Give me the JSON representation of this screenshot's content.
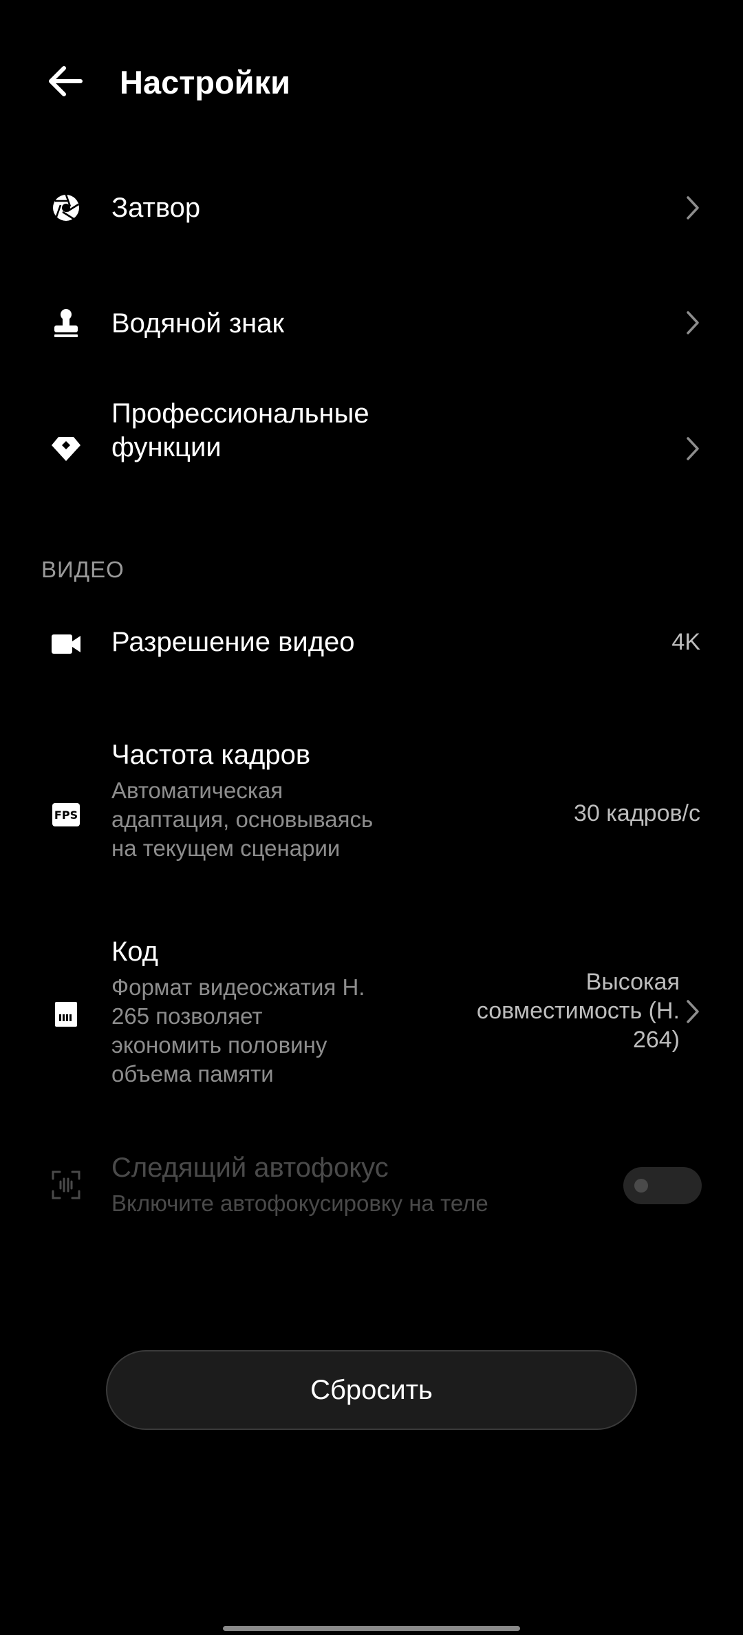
{
  "header": {
    "title": "Настройки",
    "back_icon": "arrow-left-icon"
  },
  "items": {
    "shutter": {
      "label": "Затвор",
      "icon": "aperture-icon"
    },
    "watermark": {
      "label": "Водяной знак",
      "icon": "stamp-icon"
    },
    "pro": {
      "label_line1": "Профессиональные",
      "label_line2": "функции",
      "icon": "diamond-icon"
    }
  },
  "video_section": {
    "header": "ВИДЕО",
    "resolution": {
      "label": "Разрешение видео",
      "value": "4K",
      "icon": "video-camera-icon"
    },
    "framerate": {
      "label": "Частота кадров",
      "subtitle_line1": "Автоматическая",
      "subtitle_line2": "адаптация, основываясь",
      "subtitle_line3": "на текущем сценарии",
      "value": "30 кадров/с",
      "icon": "fps-icon",
      "icon_text": "FPS"
    },
    "codec": {
      "label": "Код",
      "subtitle_line1": "Формат видеосжатия H.",
      "subtitle_line2": "265 позволяет",
      "subtitle_line3": "экономить половину",
      "subtitle_line4": "объема памяти",
      "value_line1": "Высокая",
      "value_line2": "совместимость (H.",
      "value_line3": "264)",
      "icon": "memory-card-icon"
    },
    "tracking_af": {
      "label": "Следящий автофокус",
      "subtitle": "Включите автофокусировку на теле",
      "enabled": false,
      "icon": "focus-tracking-icon"
    }
  },
  "reset_button": {
    "label": "Сбросить"
  },
  "colors": {
    "background": "#000000",
    "text_primary": "#ffffff",
    "text_secondary": "#8d8d8d",
    "text_disabled": "#4a4a4a",
    "button_bg": "#1c1c1c"
  }
}
